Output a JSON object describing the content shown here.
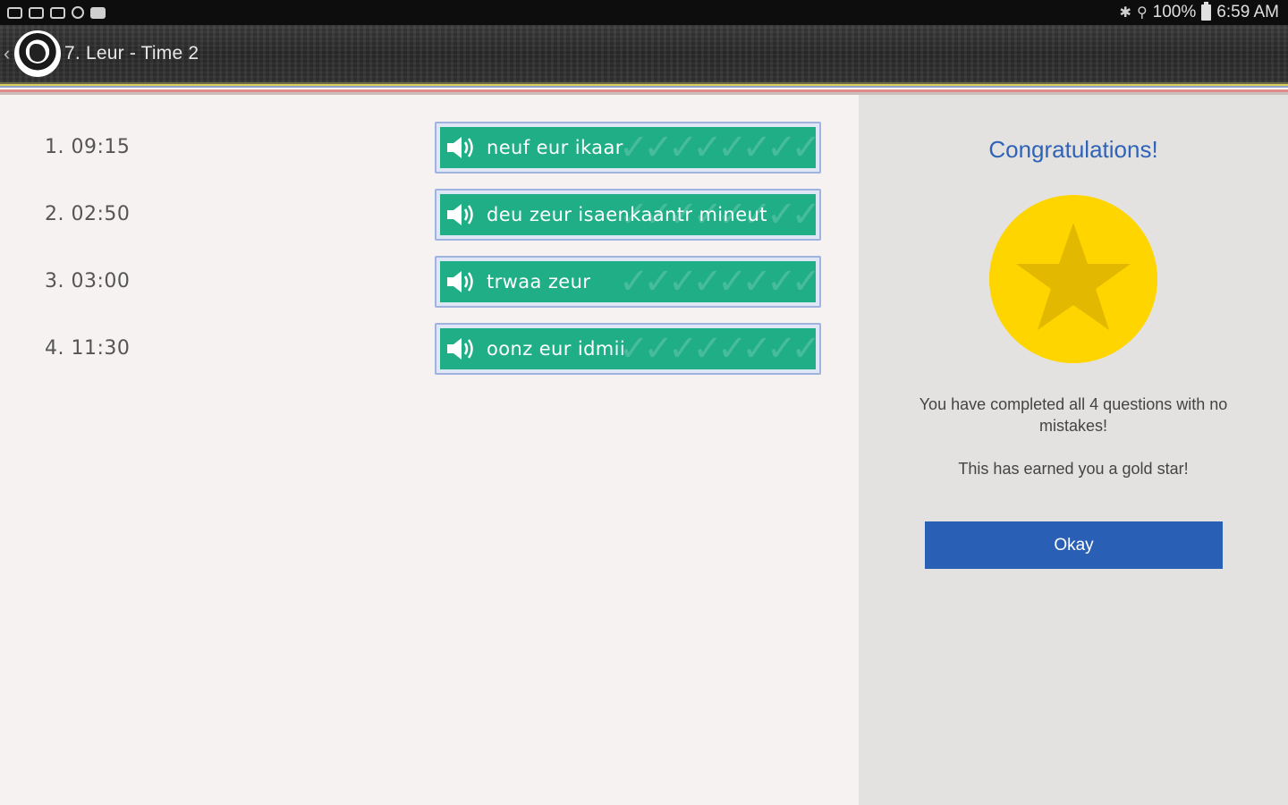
{
  "status_bar": {
    "battery": "100%",
    "time": "6:59 AM",
    "left_icons": [
      "gamepad-icon",
      "image-icon",
      "gallery-icon",
      "browser-icon",
      "video-icon"
    ]
  },
  "app_bar": {
    "title": "7. Leur - Time 2",
    "logo": "app-logo"
  },
  "questions": [
    {
      "number_label": "1. 09:15",
      "answer": "neuf eur ikaar"
    },
    {
      "number_label": "2. 02:50",
      "answer": "deu zeur isaenkaantr mineut"
    },
    {
      "number_label": "3. 03:00",
      "answer": "trwaa zeur"
    },
    {
      "number_label": "4. 11:30",
      "answer": "oonz eur idmii"
    }
  ],
  "result_panel": {
    "heading": "Congratulations!",
    "message_line1": "You have completed all 4 questions with no mistakes!",
    "message_line2": "This has earned you a gold star!",
    "okay_label": "Okay"
  },
  "colors": {
    "answer_green": "#1fae86",
    "accent_blue": "#2960b6",
    "heading_blue": "#2f63b8",
    "star_gold": "#ffd500",
    "star_dark": "#e2b800"
  }
}
